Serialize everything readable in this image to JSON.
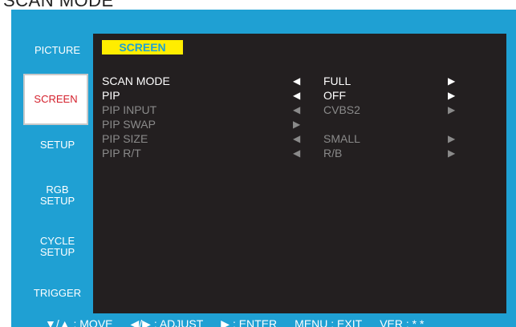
{
  "doc_heading": "SCAN MODE",
  "sidebar": {
    "items": [
      {
        "label": "PICTURE"
      },
      {
        "label": "SCREEN"
      },
      {
        "label": "SETUP"
      },
      {
        "label": "RGB\nSETUP"
      },
      {
        "label": "CYCLE\nSETUP"
      },
      {
        "label": "TRIGGER"
      }
    ],
    "active_index": 1
  },
  "screen": {
    "title": "SCREEN",
    "rows": [
      {
        "name": "SCAN MODE",
        "left_arrow": "◀",
        "value": "FULL",
        "right_arrow": "▶",
        "enabled": true
      },
      {
        "name": "PIP",
        "left_arrow": "◀",
        "value": "OFF",
        "right_arrow": "▶",
        "enabled": true
      },
      {
        "name": "PIP INPUT",
        "left_arrow": "◀",
        "value": "CVBS2",
        "right_arrow": "▶",
        "enabled": false
      },
      {
        "name": "PIP SWAP",
        "left_arrow": "▶",
        "value": "",
        "right_arrow": "",
        "enabled": false
      },
      {
        "name": "PIP SIZE",
        "left_arrow": "◀",
        "value": "SMALL",
        "right_arrow": "▶",
        "enabled": false
      },
      {
        "name": "PIP R/T",
        "left_arrow": "◀",
        "value": "R/B",
        "right_arrow": "▶",
        "enabled": false
      }
    ]
  },
  "footer": {
    "move": "▼/▲ : MOVE",
    "adjust": "◀/▶ : ADJUST",
    "enter": "▶ : ENTER",
    "exit": "MENU : EXIT",
    "ver": "VER : * *"
  },
  "colors": {
    "frame": "#1fa0d3",
    "screen": "#231f20",
    "title_bg": "#ffed00",
    "active_text": "#d4202c",
    "disabled_text": "#8a8a8a"
  }
}
